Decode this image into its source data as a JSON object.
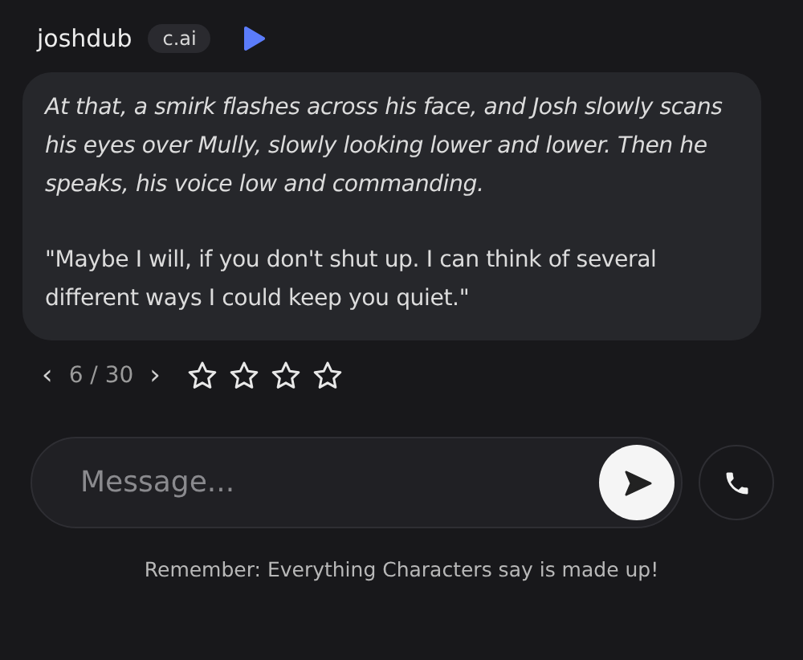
{
  "header": {
    "name": "joshdub",
    "badge": "c.ai"
  },
  "message": {
    "paragraphs": [
      {
        "kind": "narration",
        "text": "At that, a smirk flashes across his face, and Josh slowly scans his eyes over Mully, slowly looking lower and lower. Then he speaks, his voice low and commanding."
      },
      {
        "kind": "speech",
        "text": "\"Maybe I will, if you don't shut up. I can think of several different ways I could keep you quiet.\""
      }
    ]
  },
  "pager": {
    "prev": "‹",
    "position": "6 / 30",
    "next": "›"
  },
  "rating": {
    "stars": 0
  },
  "composer": {
    "placeholder": "Message..."
  },
  "disclaimer": "Remember: Everything Characters say is made up!"
}
